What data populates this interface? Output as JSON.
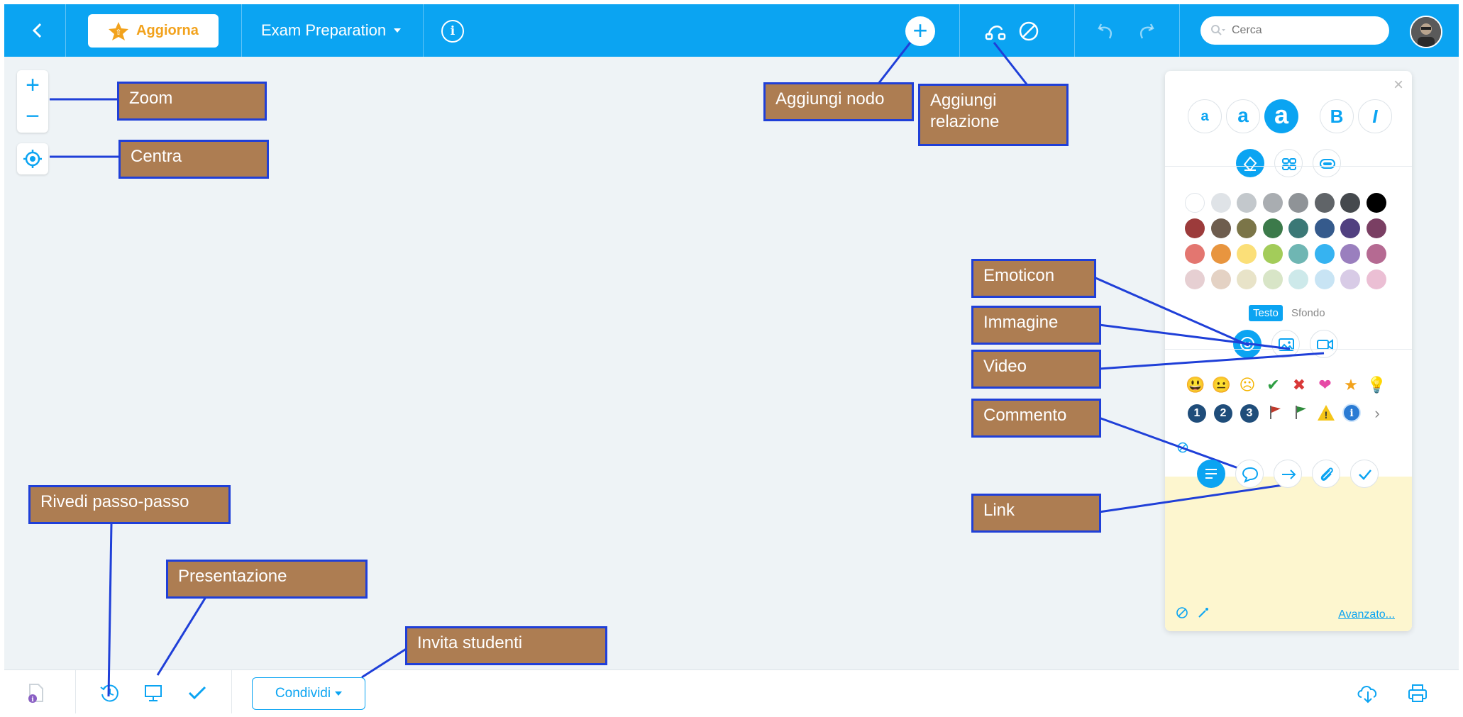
{
  "topbar": {
    "back_icon": "chevron-left-icon",
    "upgrade_label": "Aggiorna",
    "upgrade_icon": "star-icon",
    "map_title": "Exam Preparation",
    "info_icon": "info-icon",
    "add_node_icon": "plus-icon",
    "add_relation_icon": "relation-icon",
    "no_icon": "prohibited-icon",
    "undo_icon": "undo-icon",
    "redo_icon": "redo-icon",
    "search_placeholder": "Cerca",
    "avatar_icon": "avatar"
  },
  "left_controls": {
    "zoom_in": "+",
    "zoom_out": "−",
    "center_icon": "target-icon"
  },
  "panel": {
    "close": "×",
    "size_small": "a",
    "size_medium": "a",
    "size_large": "a",
    "bold": "B",
    "italic": "I",
    "color_rows": [
      [
        "#ffffff",
        "#dfe3e7",
        "#c3c8cc",
        "#a9adb1",
        "#8f9397",
        "#606468",
        "#45494d",
        "#000000"
      ],
      [
        "#9c3b3b",
        "#6e5d4e",
        "#7b7548",
        "#3c7a4a",
        "#3b7876",
        "#355a8c",
        "#514080",
        "#7a3f63"
      ],
      [
        "#e37670",
        "#e8953f",
        "#fbdf78",
        "#a3cc5a",
        "#6fb6b3",
        "#36b3f1",
        "#9a7fbe",
        "#b56a92"
      ],
      [
        "#e6cfd2",
        "#e4d2c4",
        "#e8e3c8",
        "#d8e5c7",
        "#cde9ea",
        "#c8e4f4",
        "#d8cbe6",
        "#ebbfd4"
      ]
    ],
    "toggle_text": "Testo",
    "toggle_background": "Sfondo",
    "emoji_row1": [
      "😃",
      "😐",
      "☹",
      "✔",
      "✖",
      "❤",
      "★",
      "💡"
    ],
    "number_icons": [
      "1",
      "2",
      "3"
    ],
    "more": "›",
    "advanced_link": "Avanzato..."
  },
  "bottombar": {
    "share_label": "Condividi"
  },
  "annotations": {
    "zoom": "Zoom",
    "center": "Centra",
    "add_node": "Aggiungi nodo",
    "add_relation": "Aggiungi relazione",
    "emoticon": "Emoticon",
    "image": "Immagine",
    "video": "Video",
    "comment": "Commento",
    "link": "Link",
    "replay": "Rivedi passo-passo",
    "presentation": "Presentazione",
    "invite": "Invita studenti"
  },
  "colors": {
    "accent": "#0ba4f2",
    "canvas": "#eef3f6",
    "callout_fill": "#ad7d52",
    "callout_border": "#1f3fd8",
    "upgrade": "#f2a21c"
  }
}
